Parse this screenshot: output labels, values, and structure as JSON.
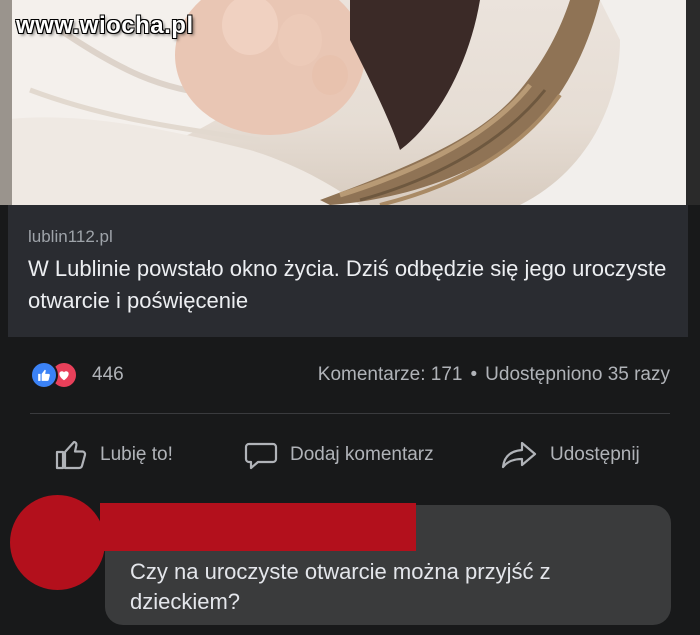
{
  "watermark": "www.wiocha.pl",
  "post": {
    "source": "lublin112.pl",
    "headline": "W Lublinie powstało okno życia. Dziś odbędzie się jego uroczyste otwarcie i poświęcenie"
  },
  "stats": {
    "reaction_count": "446",
    "comments": "Komentarze: 171",
    "separator": "•",
    "shares": "Udostępniono 35 razy"
  },
  "actions": {
    "like": "Lubię to!",
    "comment": "Dodaj komentarz",
    "share": "Udostępnij"
  },
  "comment": {
    "text": "Czy na uroczyste otwarcie można przyjść z dzieckiem?"
  },
  "colors": {
    "background": "#18191a",
    "card": "#2a2c31",
    "bubble": "#3a3b3c",
    "redaction": "#b3101c",
    "like_blue": "#3b82f6",
    "love_red": "#e8405a"
  },
  "icons": [
    "thumbs-up-icon",
    "heart-icon",
    "like-outline-icon",
    "comment-icon",
    "share-arrow-icon"
  ]
}
